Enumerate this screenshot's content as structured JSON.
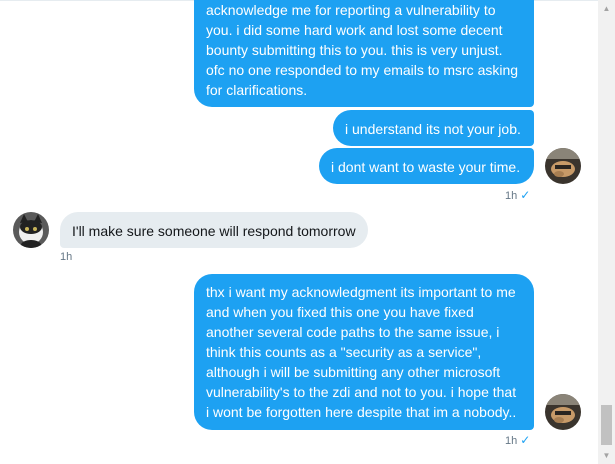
{
  "messages": [
    {
      "direction": "out",
      "lines": [
        "acknowledge me for reporting a vulnerability to",
        "you. i did some hard work and lost some decent",
        "bounty submitting this to you. this is very unjust.",
        "ofc no one responded to my emails to msrc asking",
        "for clarifications."
      ]
    },
    {
      "direction": "out",
      "lines": [
        "i understand its not your job."
      ]
    },
    {
      "direction": "out",
      "lines": [
        "i dont want to waste your time."
      ]
    },
    {
      "direction": "in",
      "lines": [
        "I'll make sure someone will respond tomorrow"
      ]
    },
    {
      "direction": "out",
      "lines": [
        "thx i want my acknowledgment its important to me",
        "and when you fixed this one you have fixed",
        "another several code paths to the same issue, i",
        "think this counts as a \"security as a service\",",
        "although i will be submitting any other microsoft",
        "vulnerability's to the zdi and not to you. i hope that",
        "i wont be forgotten here despite that im a nobody.."
      ]
    }
  ],
  "timestamps": {
    "out_group_1": "1h",
    "in_group": "1h",
    "out_group_2": "1h"
  },
  "icons": {
    "read_receipt": "checkmark-icon",
    "own_avatar": "user-avatar-icon",
    "other_avatar": "contact-avatar-icon"
  },
  "colors": {
    "outgoing_bubble": "#1da1f2",
    "incoming_bubble": "#e6ecf0",
    "timestamp": "#657786"
  }
}
